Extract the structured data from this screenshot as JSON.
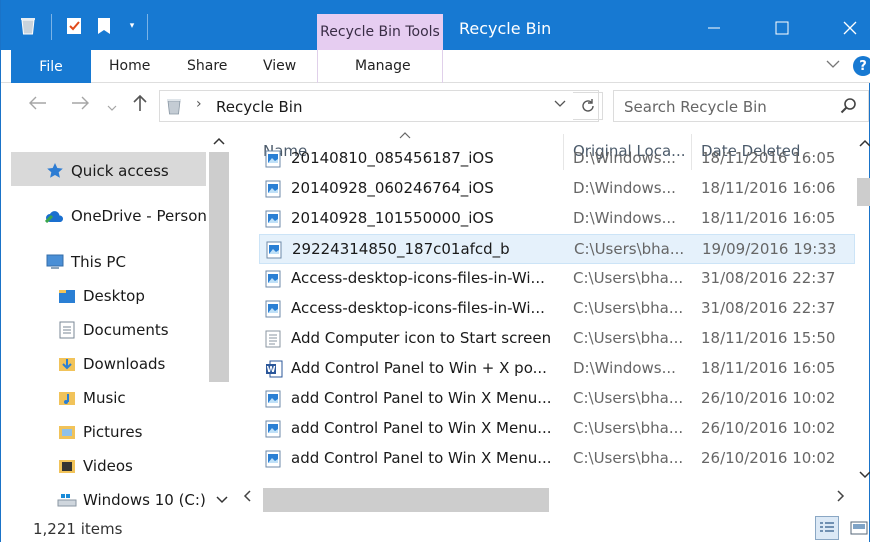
{
  "window": {
    "title": "Recycle Bin",
    "context_tab": "Recycle Bin Tools",
    "accent": "#1779d2",
    "context_color": "#e6cdf1"
  },
  "ribbon": {
    "file": "File",
    "tabs": [
      "Home",
      "Share",
      "View"
    ],
    "manage": "Manage"
  },
  "address": {
    "path": "Recycle Bin",
    "search_placeholder": "Search Recycle Bin"
  },
  "nav": {
    "quick_access": "Quick access",
    "onedrive": "OneDrive - Person",
    "this_pc": "This PC",
    "desktop": "Desktop",
    "documents": "Documents",
    "downloads": "Downloads",
    "music": "Music",
    "pictures": "Pictures",
    "videos": "Videos",
    "drive": "Windows 10 (C:)"
  },
  "columns": {
    "name": "Name",
    "location": "Original Loca...",
    "date": "Date Deleted"
  },
  "files": [
    {
      "name": "20140810_085456187_iOS",
      "location": "D:\\Windows...",
      "date": "18/11/2016 16:05",
      "icon": "image-icon"
    },
    {
      "name": "20140928_060246764_iOS",
      "location": "D:\\Windows...",
      "date": "18/11/2016 16:06",
      "icon": "image-icon"
    },
    {
      "name": "20140928_101550000_iOS",
      "location": "D:\\Windows...",
      "date": "18/11/2016 16:05",
      "icon": "image-icon"
    },
    {
      "name": "29224314850_187c01afcd_b",
      "location": "C:\\Users\\bha...",
      "date": "19/09/2016 19:33",
      "icon": "image-icon"
    },
    {
      "name": "Access-desktop-icons-files-in-Wi...",
      "location": "C:\\Users\\bha...",
      "date": "31/08/2016 22:37",
      "icon": "image-icon"
    },
    {
      "name": "Access-desktop-icons-files-in-Wi...",
      "location": "C:\\Users\\bha...",
      "date": "31/08/2016 22:37",
      "icon": "image-icon"
    },
    {
      "name": "Add Computer icon to Start screen",
      "location": "C:\\Users\\bha...",
      "date": "18/11/2016 15:50",
      "icon": "text-file-icon"
    },
    {
      "name": "Add Control Panel to Win + X po...",
      "location": "D:\\Windows...",
      "date": "18/11/2016 16:05",
      "icon": "word-doc-icon"
    },
    {
      "name": "add Control Panel to Win X Menu...",
      "location": "C:\\Users\\bha...",
      "date": "26/10/2016 10:02",
      "icon": "image-icon"
    },
    {
      "name": "add Control Panel to Win X Menu...",
      "location": "C:\\Users\\bha...",
      "date": "26/10/2016 10:02",
      "icon": "image-icon"
    },
    {
      "name": "add Control Panel to Win X Menu...",
      "location": "C:\\Users\\bha...",
      "date": "26/10/2016 10:02",
      "icon": "image-icon"
    }
  ],
  "status": {
    "count": "1,221 items"
  }
}
